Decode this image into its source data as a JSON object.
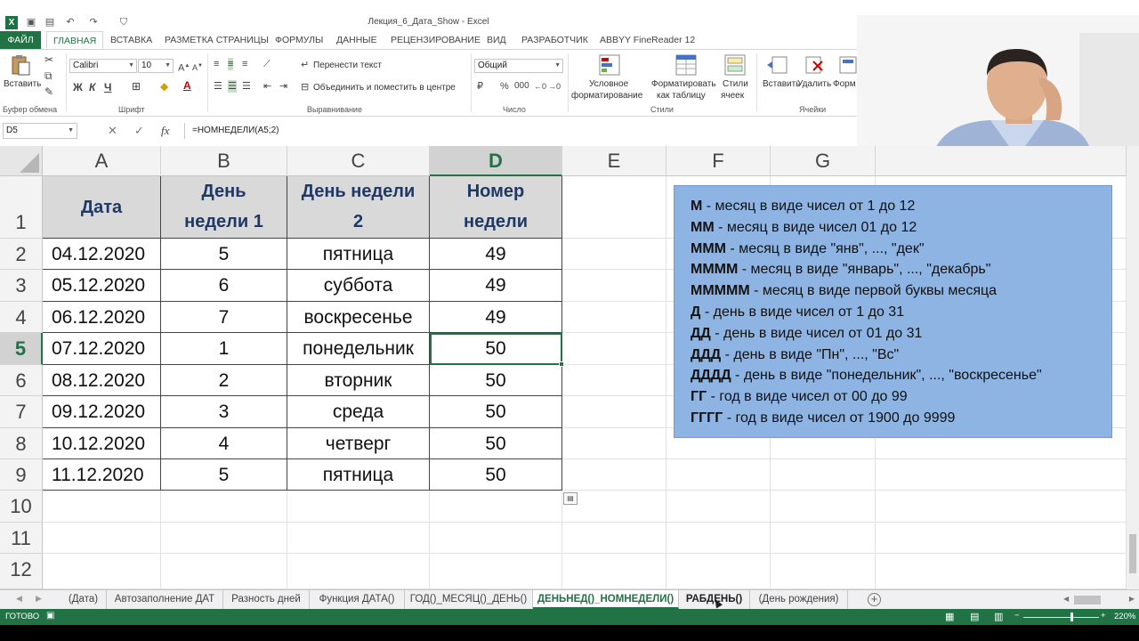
{
  "window": {
    "title": "Лекция_6_Дата_Show - Excel"
  },
  "ribbon_tabs": [
    {
      "label": "ФАЙЛ"
    },
    {
      "label": "ГЛАВНАЯ"
    },
    {
      "label": "ВСТАВКА"
    },
    {
      "label": "РАЗМЕТКА СТРАНИЦЫ"
    },
    {
      "label": "ФОРМУЛЫ"
    },
    {
      "label": "ДАННЫЕ"
    },
    {
      "label": "РЕЦЕНЗИРОВАНИЕ"
    },
    {
      "label": "ВИД"
    },
    {
      "label": "РАЗРАБОТЧИК"
    },
    {
      "label": "ABBYY FineReader 12"
    }
  ],
  "ribbon": {
    "paste_label": "Вставить",
    "clipboard_group": "Буфер обмена",
    "font_name": "Calibri",
    "font_size": "10",
    "bold": "Ж",
    "italic": "К",
    "underline": "Ч",
    "font_group": "Шрифт",
    "wrap_text": "Перенести текст",
    "merge_center": "Объединить и поместить в центре",
    "alignment_group": "Выравнивание",
    "number_format": "Общий",
    "number_group": "Число",
    "cond_format_1": "Условное",
    "cond_format_2": "форматирование",
    "format_table_1": "Форматировать",
    "format_table_2": "как таблицу",
    "cell_styles_1": "Стили",
    "cell_styles_2": "ячеек",
    "styles_group": "Стили",
    "insert_label": "Вставить",
    "delete_label": "Удалить",
    "format_label": "Форм",
    "cells_group": "Ячейки"
  },
  "formula_bar": {
    "name_box": "D5",
    "formula": "=НОМНЕДЕЛИ(A5;2)"
  },
  "columns": [
    "A",
    "B",
    "C",
    "D",
    "E",
    "F",
    "G"
  ],
  "rows": [
    "1",
    "2",
    "3",
    "4",
    "5",
    "6",
    "7",
    "8",
    "9",
    "10",
    "11",
    "12"
  ],
  "table": {
    "headers": {
      "a": "Дата",
      "b1": "День",
      "b2": "недели 1",
      "c1": "День недели",
      "c2": "2",
      "d1": "Номер",
      "d2": "недели"
    },
    "rows": [
      {
        "date": "04.12.2020",
        "day1": "5",
        "day2": "пятница",
        "week": "49"
      },
      {
        "date": "05.12.2020",
        "day1": "6",
        "day2": "суббота",
        "week": "49"
      },
      {
        "date": "06.12.2020",
        "day1": "7",
        "day2": "воскресенье",
        "week": "49"
      },
      {
        "date": "07.12.2020",
        "day1": "1",
        "day2": "понедельник",
        "week": "50"
      },
      {
        "date": "08.12.2020",
        "day1": "2",
        "day2": "вторник",
        "week": "50"
      },
      {
        "date": "09.12.2020",
        "day1": "3",
        "day2": "среда",
        "week": "50"
      },
      {
        "date": "10.12.2020",
        "day1": "4",
        "day2": "четверг",
        "week": "50"
      },
      {
        "date": "11.12.2020",
        "day1": "5",
        "day2": "пятница",
        "week": "50"
      }
    ]
  },
  "note": [
    {
      "code": "М",
      "text": " - месяц в виде чисел от 1 до 12"
    },
    {
      "code": "ММ",
      "text": " - месяц в виде чисел 01 до 12"
    },
    {
      "code": "МММ",
      "text": " - месяц в виде \"янв\", ..., \"дек\""
    },
    {
      "code": "ММММ",
      "text": " - месяц в виде \"январь\", ..., \"декабрь\""
    },
    {
      "code": "МММММ",
      "text": " - месяц в виде первой буквы месяца"
    },
    {
      "code": "Д",
      "text": " - день в виде чисел от 1 до 31"
    },
    {
      "code": "ДД",
      "text": " - день в виде чисел от 01 до 31"
    },
    {
      "code": "ДДД",
      "text": " - день в виде \"Пн\", ..., \"Вс\""
    },
    {
      "code": "ДДДД",
      "text": " - день в виде \"понедельник\", ..., \"воскресенье\""
    },
    {
      "code": "ГГ",
      "text": " - год в виде чисел от 00 до 99"
    },
    {
      "code": "ГГГГ",
      "text": " - год в виде чисел от 1900 до 9999"
    }
  ],
  "sheet_tabs": [
    {
      "label": "(Дата)"
    },
    {
      "label": "Автозаполнение ДАТ"
    },
    {
      "label": "Разность дней"
    },
    {
      "label": "Функция ДАТА()"
    },
    {
      "label": "ГОД()_МЕСЯЦ()_ДЕНЬ()"
    },
    {
      "label": "ДЕНЬНЕД()_НОМНЕДЕЛИ()"
    },
    {
      "label": "РАБДЕНЬ()"
    },
    {
      "label": "(День рождения)"
    }
  ],
  "status": {
    "ready": "ГОТОВО",
    "zoom": "220%"
  },
  "colors": {
    "excel_green": "#217346",
    "note_fill": "#8eb4e3",
    "header_fill": "#d9d9d9"
  }
}
